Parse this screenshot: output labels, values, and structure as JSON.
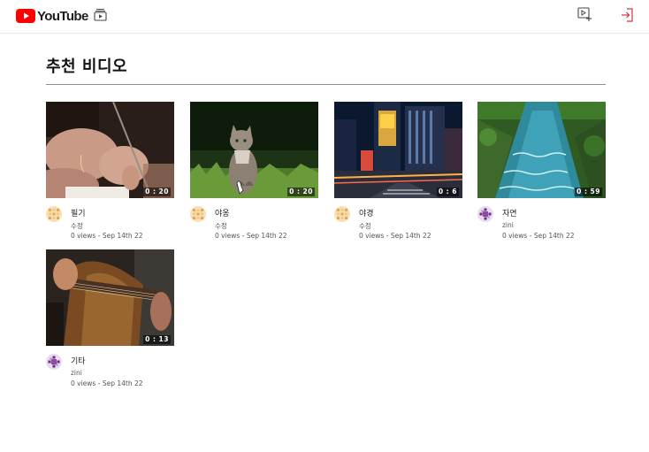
{
  "header": {
    "logo_text": "YouTube",
    "logo_icon": "youtube-play-icon",
    "subscriptions_icon": "subscriptions-icon",
    "upload_icon": "video-upload-icon",
    "logout_icon": "logout-icon",
    "brand_color": "#ff0000"
  },
  "main": {
    "title": "추천 비디오"
  },
  "videos": [
    {
      "title": "필기",
      "channel": "수정",
      "views": "0 views",
      "date": "Sep 14th 22",
      "duration": "0 : 20",
      "avatar": "yellow-pattern-avatar"
    },
    {
      "title": "야옹",
      "channel": "수정",
      "views": "0 views",
      "date": "Sep 14th 22",
      "duration": "0 : 20",
      "avatar": "yellow-pattern-avatar"
    },
    {
      "title": "야경",
      "channel": "수정",
      "views": "0 views",
      "date": "Sep 14th 22",
      "duration": "0 : 6",
      "avatar": "yellow-pattern-avatar"
    },
    {
      "title": "자연",
      "channel": "zini",
      "views": "0 views",
      "date": "Sep 14th 22",
      "duration": "0 : 59",
      "avatar": "purple-pattern-avatar"
    },
    {
      "title": "기타",
      "channel": "zini",
      "views": "0 views",
      "date": "Sep 14th 22",
      "duration": "0 : 13",
      "avatar": "purple-pattern-avatar"
    }
  ]
}
